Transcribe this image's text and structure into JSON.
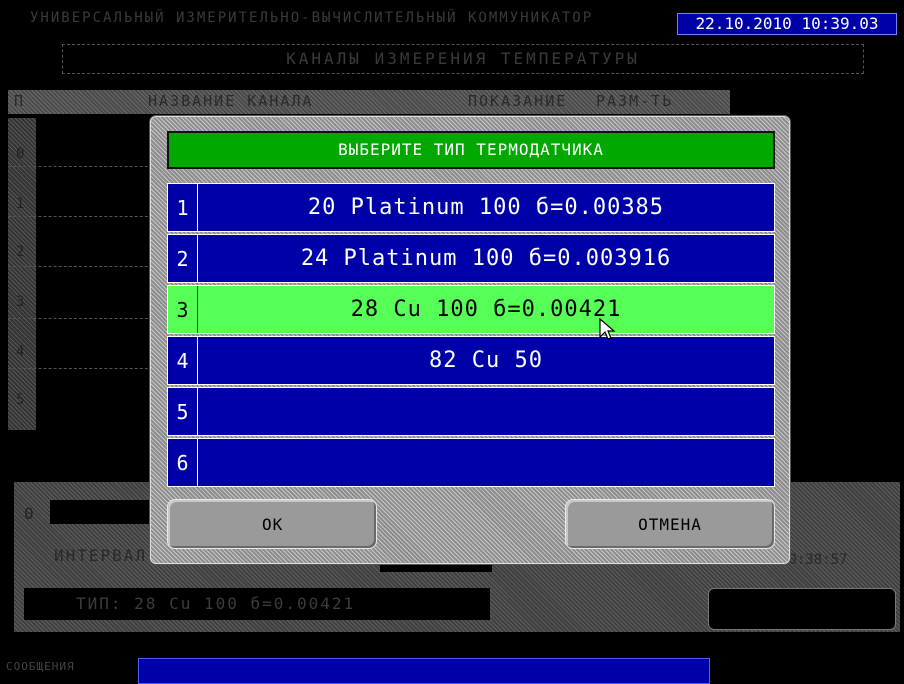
{
  "app": {
    "title": "УНИВЕРСАЛЬНЫЙ ИЗМЕРИТЕЛЬНО-ВЫЧИСЛИТЕЛЬНЫЙ КОММУНИКАТОР",
    "datetime": "22.10.2010 10:39.03"
  },
  "screen": {
    "header": "КАНАЛЫ ИЗМЕРЕНИЯ ТЕМПЕРАТУРЫ",
    "col_number": "П",
    "col_name": "НАЗВАНИЕ КАНАЛА",
    "col_value": "ПОКАЗАНИЕ",
    "col_unit": "РАЗМ-ТЬ",
    "row_numbers": [
      "0",
      "1",
      "2",
      "3",
      "4",
      "5"
    ],
    "bottom_index": "0",
    "interval_label": "ИНТЕРВАЛ",
    "type_line": "ТИП: 28 Cu 100 б=0.00421",
    "time_small": "10:38:57",
    "messages_label": "СООБЩЕНИЯ"
  },
  "dialog": {
    "title": "ВЫБЕРИТЕ ТИП ТЕРМОДАТЧИКА",
    "items": [
      {
        "num": "1",
        "label": "20 Platinum 100 б=0.00385"
      },
      {
        "num": "2",
        "label": "24 Platinum 100 б=0.003916"
      },
      {
        "num": "3",
        "label": "28 Cu 100 б=0.00421"
      },
      {
        "num": "4",
        "label": "82 Cu 50"
      },
      {
        "num": "5",
        "label": ""
      },
      {
        "num": "6",
        "label": ""
      }
    ],
    "selected_index": 2,
    "ok_label": "OK",
    "cancel_label": "ОТМЕНА"
  },
  "colors": {
    "list_bg": "#0000a8",
    "selected_bg": "#56ff56",
    "title_bg": "#00a800"
  }
}
